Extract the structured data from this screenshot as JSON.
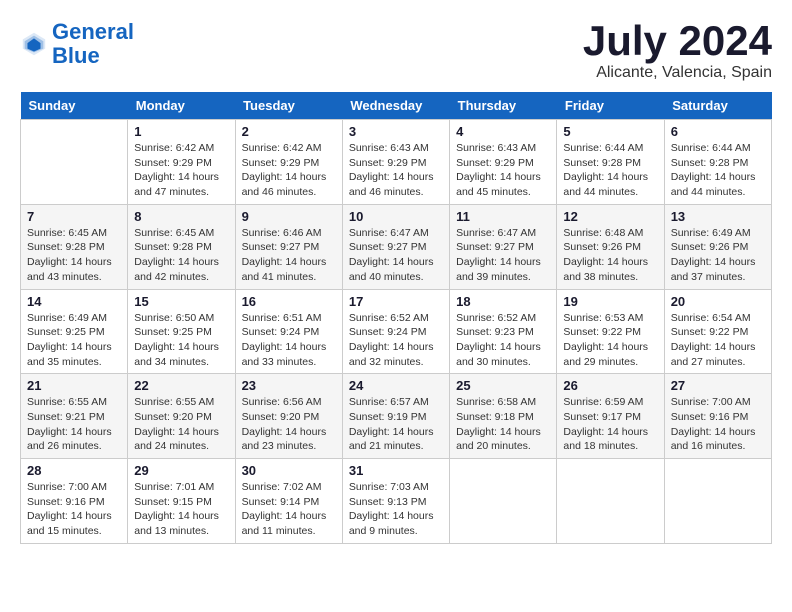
{
  "header": {
    "logo_line1": "General",
    "logo_line2": "Blue",
    "month": "July 2024",
    "location": "Alicante, Valencia, Spain"
  },
  "weekdays": [
    "Sunday",
    "Monday",
    "Tuesday",
    "Wednesday",
    "Thursday",
    "Friday",
    "Saturday"
  ],
  "weeks": [
    [
      {
        "day": "",
        "sunrise": "",
        "sunset": "",
        "daylight": ""
      },
      {
        "day": "1",
        "sunrise": "Sunrise: 6:42 AM",
        "sunset": "Sunset: 9:29 PM",
        "daylight": "Daylight: 14 hours and 47 minutes."
      },
      {
        "day": "2",
        "sunrise": "Sunrise: 6:42 AM",
        "sunset": "Sunset: 9:29 PM",
        "daylight": "Daylight: 14 hours and 46 minutes."
      },
      {
        "day": "3",
        "sunrise": "Sunrise: 6:43 AM",
        "sunset": "Sunset: 9:29 PM",
        "daylight": "Daylight: 14 hours and 46 minutes."
      },
      {
        "day": "4",
        "sunrise": "Sunrise: 6:43 AM",
        "sunset": "Sunset: 9:29 PM",
        "daylight": "Daylight: 14 hours and 45 minutes."
      },
      {
        "day": "5",
        "sunrise": "Sunrise: 6:44 AM",
        "sunset": "Sunset: 9:28 PM",
        "daylight": "Daylight: 14 hours and 44 minutes."
      },
      {
        "day": "6",
        "sunrise": "Sunrise: 6:44 AM",
        "sunset": "Sunset: 9:28 PM",
        "daylight": "Daylight: 14 hours and 44 minutes."
      }
    ],
    [
      {
        "day": "7",
        "sunrise": "Sunrise: 6:45 AM",
        "sunset": "Sunset: 9:28 PM",
        "daylight": "Daylight: 14 hours and 43 minutes."
      },
      {
        "day": "8",
        "sunrise": "Sunrise: 6:45 AM",
        "sunset": "Sunset: 9:28 PM",
        "daylight": "Daylight: 14 hours and 42 minutes."
      },
      {
        "day": "9",
        "sunrise": "Sunrise: 6:46 AM",
        "sunset": "Sunset: 9:27 PM",
        "daylight": "Daylight: 14 hours and 41 minutes."
      },
      {
        "day": "10",
        "sunrise": "Sunrise: 6:47 AM",
        "sunset": "Sunset: 9:27 PM",
        "daylight": "Daylight: 14 hours and 40 minutes."
      },
      {
        "day": "11",
        "sunrise": "Sunrise: 6:47 AM",
        "sunset": "Sunset: 9:27 PM",
        "daylight": "Daylight: 14 hours and 39 minutes."
      },
      {
        "day": "12",
        "sunrise": "Sunrise: 6:48 AM",
        "sunset": "Sunset: 9:26 PM",
        "daylight": "Daylight: 14 hours and 38 minutes."
      },
      {
        "day": "13",
        "sunrise": "Sunrise: 6:49 AM",
        "sunset": "Sunset: 9:26 PM",
        "daylight": "Daylight: 14 hours and 37 minutes."
      }
    ],
    [
      {
        "day": "14",
        "sunrise": "Sunrise: 6:49 AM",
        "sunset": "Sunset: 9:25 PM",
        "daylight": "Daylight: 14 hours and 35 minutes."
      },
      {
        "day": "15",
        "sunrise": "Sunrise: 6:50 AM",
        "sunset": "Sunset: 9:25 PM",
        "daylight": "Daylight: 14 hours and 34 minutes."
      },
      {
        "day": "16",
        "sunrise": "Sunrise: 6:51 AM",
        "sunset": "Sunset: 9:24 PM",
        "daylight": "Daylight: 14 hours and 33 minutes."
      },
      {
        "day": "17",
        "sunrise": "Sunrise: 6:52 AM",
        "sunset": "Sunset: 9:24 PM",
        "daylight": "Daylight: 14 hours and 32 minutes."
      },
      {
        "day": "18",
        "sunrise": "Sunrise: 6:52 AM",
        "sunset": "Sunset: 9:23 PM",
        "daylight": "Daylight: 14 hours and 30 minutes."
      },
      {
        "day": "19",
        "sunrise": "Sunrise: 6:53 AM",
        "sunset": "Sunset: 9:22 PM",
        "daylight": "Daylight: 14 hours and 29 minutes."
      },
      {
        "day": "20",
        "sunrise": "Sunrise: 6:54 AM",
        "sunset": "Sunset: 9:22 PM",
        "daylight": "Daylight: 14 hours and 27 minutes."
      }
    ],
    [
      {
        "day": "21",
        "sunrise": "Sunrise: 6:55 AM",
        "sunset": "Sunset: 9:21 PM",
        "daylight": "Daylight: 14 hours and 26 minutes."
      },
      {
        "day": "22",
        "sunrise": "Sunrise: 6:55 AM",
        "sunset": "Sunset: 9:20 PM",
        "daylight": "Daylight: 14 hours and 24 minutes."
      },
      {
        "day": "23",
        "sunrise": "Sunrise: 6:56 AM",
        "sunset": "Sunset: 9:20 PM",
        "daylight": "Daylight: 14 hours and 23 minutes."
      },
      {
        "day": "24",
        "sunrise": "Sunrise: 6:57 AM",
        "sunset": "Sunset: 9:19 PM",
        "daylight": "Daylight: 14 hours and 21 minutes."
      },
      {
        "day": "25",
        "sunrise": "Sunrise: 6:58 AM",
        "sunset": "Sunset: 9:18 PM",
        "daylight": "Daylight: 14 hours and 20 minutes."
      },
      {
        "day": "26",
        "sunrise": "Sunrise: 6:59 AM",
        "sunset": "Sunset: 9:17 PM",
        "daylight": "Daylight: 14 hours and 18 minutes."
      },
      {
        "day": "27",
        "sunrise": "Sunrise: 7:00 AM",
        "sunset": "Sunset: 9:16 PM",
        "daylight": "Daylight: 14 hours and 16 minutes."
      }
    ],
    [
      {
        "day": "28",
        "sunrise": "Sunrise: 7:00 AM",
        "sunset": "Sunset: 9:16 PM",
        "daylight": "Daylight: 14 hours and 15 minutes."
      },
      {
        "day": "29",
        "sunrise": "Sunrise: 7:01 AM",
        "sunset": "Sunset: 9:15 PM",
        "daylight": "Daylight: 14 hours and 13 minutes."
      },
      {
        "day": "30",
        "sunrise": "Sunrise: 7:02 AM",
        "sunset": "Sunset: 9:14 PM",
        "daylight": "Daylight: 14 hours and 11 minutes."
      },
      {
        "day": "31",
        "sunrise": "Sunrise: 7:03 AM",
        "sunset": "Sunset: 9:13 PM",
        "daylight": "Daylight: 14 hours and 9 minutes."
      },
      {
        "day": "",
        "sunrise": "",
        "sunset": "",
        "daylight": ""
      },
      {
        "day": "",
        "sunrise": "",
        "sunset": "",
        "daylight": ""
      },
      {
        "day": "",
        "sunrise": "",
        "sunset": "",
        "daylight": ""
      }
    ]
  ]
}
